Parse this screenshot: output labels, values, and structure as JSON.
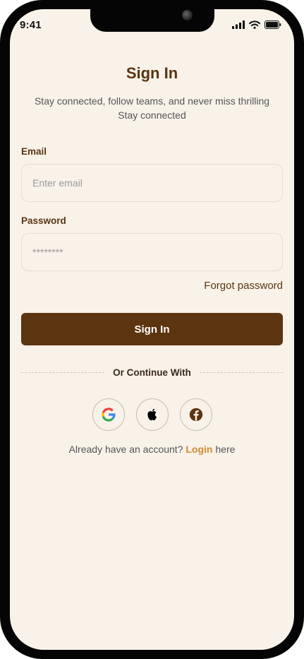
{
  "status_bar": {
    "time": "9:41",
    "icons": [
      "signal-icon",
      "wifi-icon",
      "battery-icon"
    ]
  },
  "header": {
    "title": "Sign In",
    "subtitle_line1": "Stay connected, follow teams, and never miss thrilling",
    "subtitle_line2": "Stay connected"
  },
  "form": {
    "email_label": "Email",
    "email_placeholder": "Enter email",
    "email_value": "",
    "password_label": "Password",
    "password_placeholder": "********",
    "password_value": "",
    "forgot_label": "Forgot password",
    "submit_label": "Sign In"
  },
  "social": {
    "divider_label": "Or Continue With",
    "providers": [
      "google-icon",
      "apple-icon",
      "facebook-icon"
    ]
  },
  "footer": {
    "prefix": "Already have an account?",
    "link": "Login",
    "suffix": "here"
  },
  "colors": {
    "background": "#F8F2E9",
    "primary": "#5C3410",
    "link": "#D28A2F",
    "frame": "#050505"
  }
}
